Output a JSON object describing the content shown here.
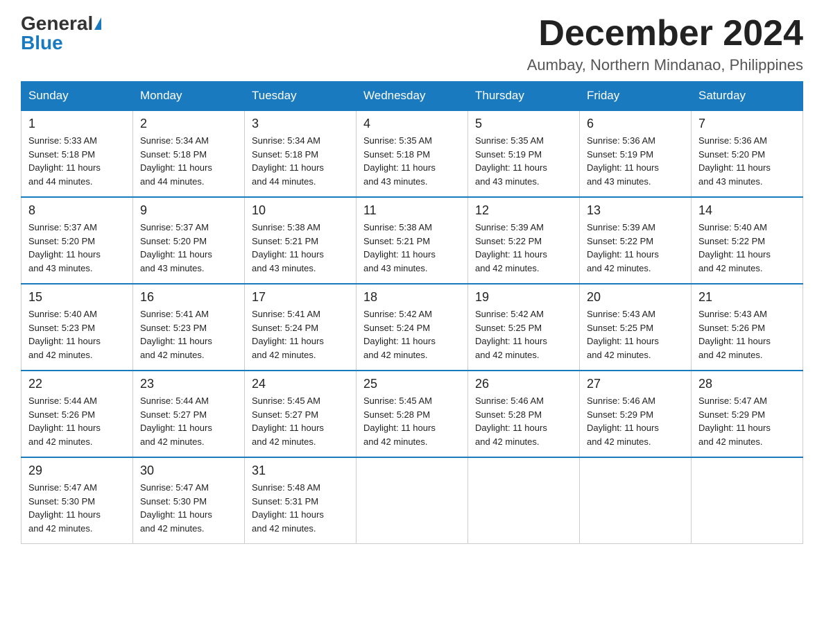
{
  "logo": {
    "general": "General",
    "blue": "Blue"
  },
  "title": "December 2024",
  "location": "Aumbay, Northern Mindanao, Philippines",
  "days_of_week": [
    "Sunday",
    "Monday",
    "Tuesday",
    "Wednesday",
    "Thursday",
    "Friday",
    "Saturday"
  ],
  "weeks": [
    [
      {
        "day": "1",
        "sunrise": "5:33 AM",
        "sunset": "5:18 PM",
        "daylight": "11 hours and 44 minutes."
      },
      {
        "day": "2",
        "sunrise": "5:34 AM",
        "sunset": "5:18 PM",
        "daylight": "11 hours and 44 minutes."
      },
      {
        "day": "3",
        "sunrise": "5:34 AM",
        "sunset": "5:18 PM",
        "daylight": "11 hours and 44 minutes."
      },
      {
        "day": "4",
        "sunrise": "5:35 AM",
        "sunset": "5:18 PM",
        "daylight": "11 hours and 43 minutes."
      },
      {
        "day": "5",
        "sunrise": "5:35 AM",
        "sunset": "5:19 PM",
        "daylight": "11 hours and 43 minutes."
      },
      {
        "day": "6",
        "sunrise": "5:36 AM",
        "sunset": "5:19 PM",
        "daylight": "11 hours and 43 minutes."
      },
      {
        "day": "7",
        "sunrise": "5:36 AM",
        "sunset": "5:20 PM",
        "daylight": "11 hours and 43 minutes."
      }
    ],
    [
      {
        "day": "8",
        "sunrise": "5:37 AM",
        "sunset": "5:20 PM",
        "daylight": "11 hours and 43 minutes."
      },
      {
        "day": "9",
        "sunrise": "5:37 AM",
        "sunset": "5:20 PM",
        "daylight": "11 hours and 43 minutes."
      },
      {
        "day": "10",
        "sunrise": "5:38 AM",
        "sunset": "5:21 PM",
        "daylight": "11 hours and 43 minutes."
      },
      {
        "day": "11",
        "sunrise": "5:38 AM",
        "sunset": "5:21 PM",
        "daylight": "11 hours and 43 minutes."
      },
      {
        "day": "12",
        "sunrise": "5:39 AM",
        "sunset": "5:22 PM",
        "daylight": "11 hours and 42 minutes."
      },
      {
        "day": "13",
        "sunrise": "5:39 AM",
        "sunset": "5:22 PM",
        "daylight": "11 hours and 42 minutes."
      },
      {
        "day": "14",
        "sunrise": "5:40 AM",
        "sunset": "5:22 PM",
        "daylight": "11 hours and 42 minutes."
      }
    ],
    [
      {
        "day": "15",
        "sunrise": "5:40 AM",
        "sunset": "5:23 PM",
        "daylight": "11 hours and 42 minutes."
      },
      {
        "day": "16",
        "sunrise": "5:41 AM",
        "sunset": "5:23 PM",
        "daylight": "11 hours and 42 minutes."
      },
      {
        "day": "17",
        "sunrise": "5:41 AM",
        "sunset": "5:24 PM",
        "daylight": "11 hours and 42 minutes."
      },
      {
        "day": "18",
        "sunrise": "5:42 AM",
        "sunset": "5:24 PM",
        "daylight": "11 hours and 42 minutes."
      },
      {
        "day": "19",
        "sunrise": "5:42 AM",
        "sunset": "5:25 PM",
        "daylight": "11 hours and 42 minutes."
      },
      {
        "day": "20",
        "sunrise": "5:43 AM",
        "sunset": "5:25 PM",
        "daylight": "11 hours and 42 minutes."
      },
      {
        "day": "21",
        "sunrise": "5:43 AM",
        "sunset": "5:26 PM",
        "daylight": "11 hours and 42 minutes."
      }
    ],
    [
      {
        "day": "22",
        "sunrise": "5:44 AM",
        "sunset": "5:26 PM",
        "daylight": "11 hours and 42 minutes."
      },
      {
        "day": "23",
        "sunrise": "5:44 AM",
        "sunset": "5:27 PM",
        "daylight": "11 hours and 42 minutes."
      },
      {
        "day": "24",
        "sunrise": "5:45 AM",
        "sunset": "5:27 PM",
        "daylight": "11 hours and 42 minutes."
      },
      {
        "day": "25",
        "sunrise": "5:45 AM",
        "sunset": "5:28 PM",
        "daylight": "11 hours and 42 minutes."
      },
      {
        "day": "26",
        "sunrise": "5:46 AM",
        "sunset": "5:28 PM",
        "daylight": "11 hours and 42 minutes."
      },
      {
        "day": "27",
        "sunrise": "5:46 AM",
        "sunset": "5:29 PM",
        "daylight": "11 hours and 42 minutes."
      },
      {
        "day": "28",
        "sunrise": "5:47 AM",
        "sunset": "5:29 PM",
        "daylight": "11 hours and 42 minutes."
      }
    ],
    [
      {
        "day": "29",
        "sunrise": "5:47 AM",
        "sunset": "5:30 PM",
        "daylight": "11 hours and 42 minutes."
      },
      {
        "day": "30",
        "sunrise": "5:47 AM",
        "sunset": "5:30 PM",
        "daylight": "11 hours and 42 minutes."
      },
      {
        "day": "31",
        "sunrise": "5:48 AM",
        "sunset": "5:31 PM",
        "daylight": "11 hours and 42 minutes."
      },
      null,
      null,
      null,
      null
    ]
  ],
  "labels": {
    "sunrise": "Sunrise:",
    "sunset": "Sunset:",
    "daylight": "Daylight:"
  }
}
